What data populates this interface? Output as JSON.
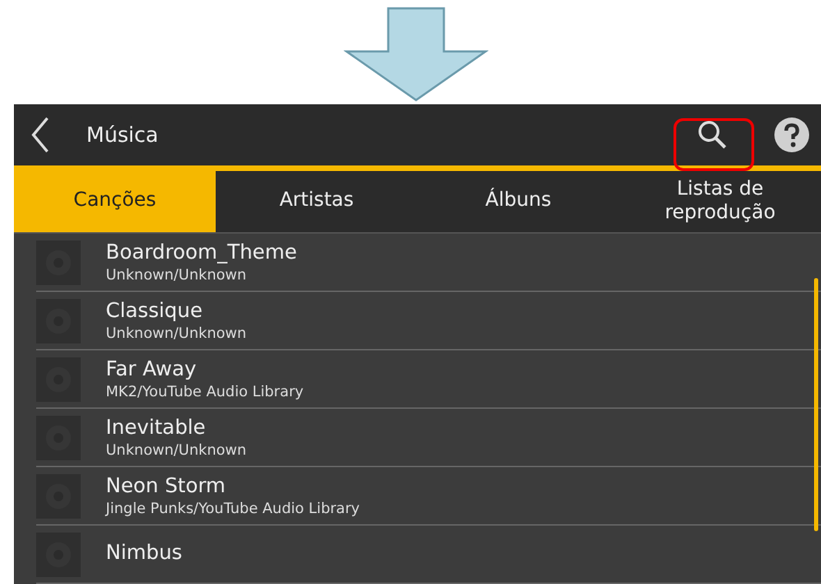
{
  "header": {
    "title": "Música",
    "search_highlighted": true
  },
  "tabs": [
    {
      "label": "Canções",
      "selected": true
    },
    {
      "label": "Artistas",
      "selected": false
    },
    {
      "label": "Álbuns",
      "selected": false
    },
    {
      "label": "Listas de reprodução",
      "selected": false
    }
  ],
  "songs": [
    {
      "title": "Boardroom_Theme",
      "artist": "Unknown/Unknown"
    },
    {
      "title": "Classique",
      "artist": "Unknown/Unknown"
    },
    {
      "title": "Far Away",
      "artist": "MK2/YouTube Audio Library"
    },
    {
      "title": "Inevitable",
      "artist": "Unknown/Unknown"
    },
    {
      "title": "Neon Storm",
      "artist": "Jingle Punks/YouTube Audio Library"
    },
    {
      "title": "Nimbus"
    }
  ]
}
